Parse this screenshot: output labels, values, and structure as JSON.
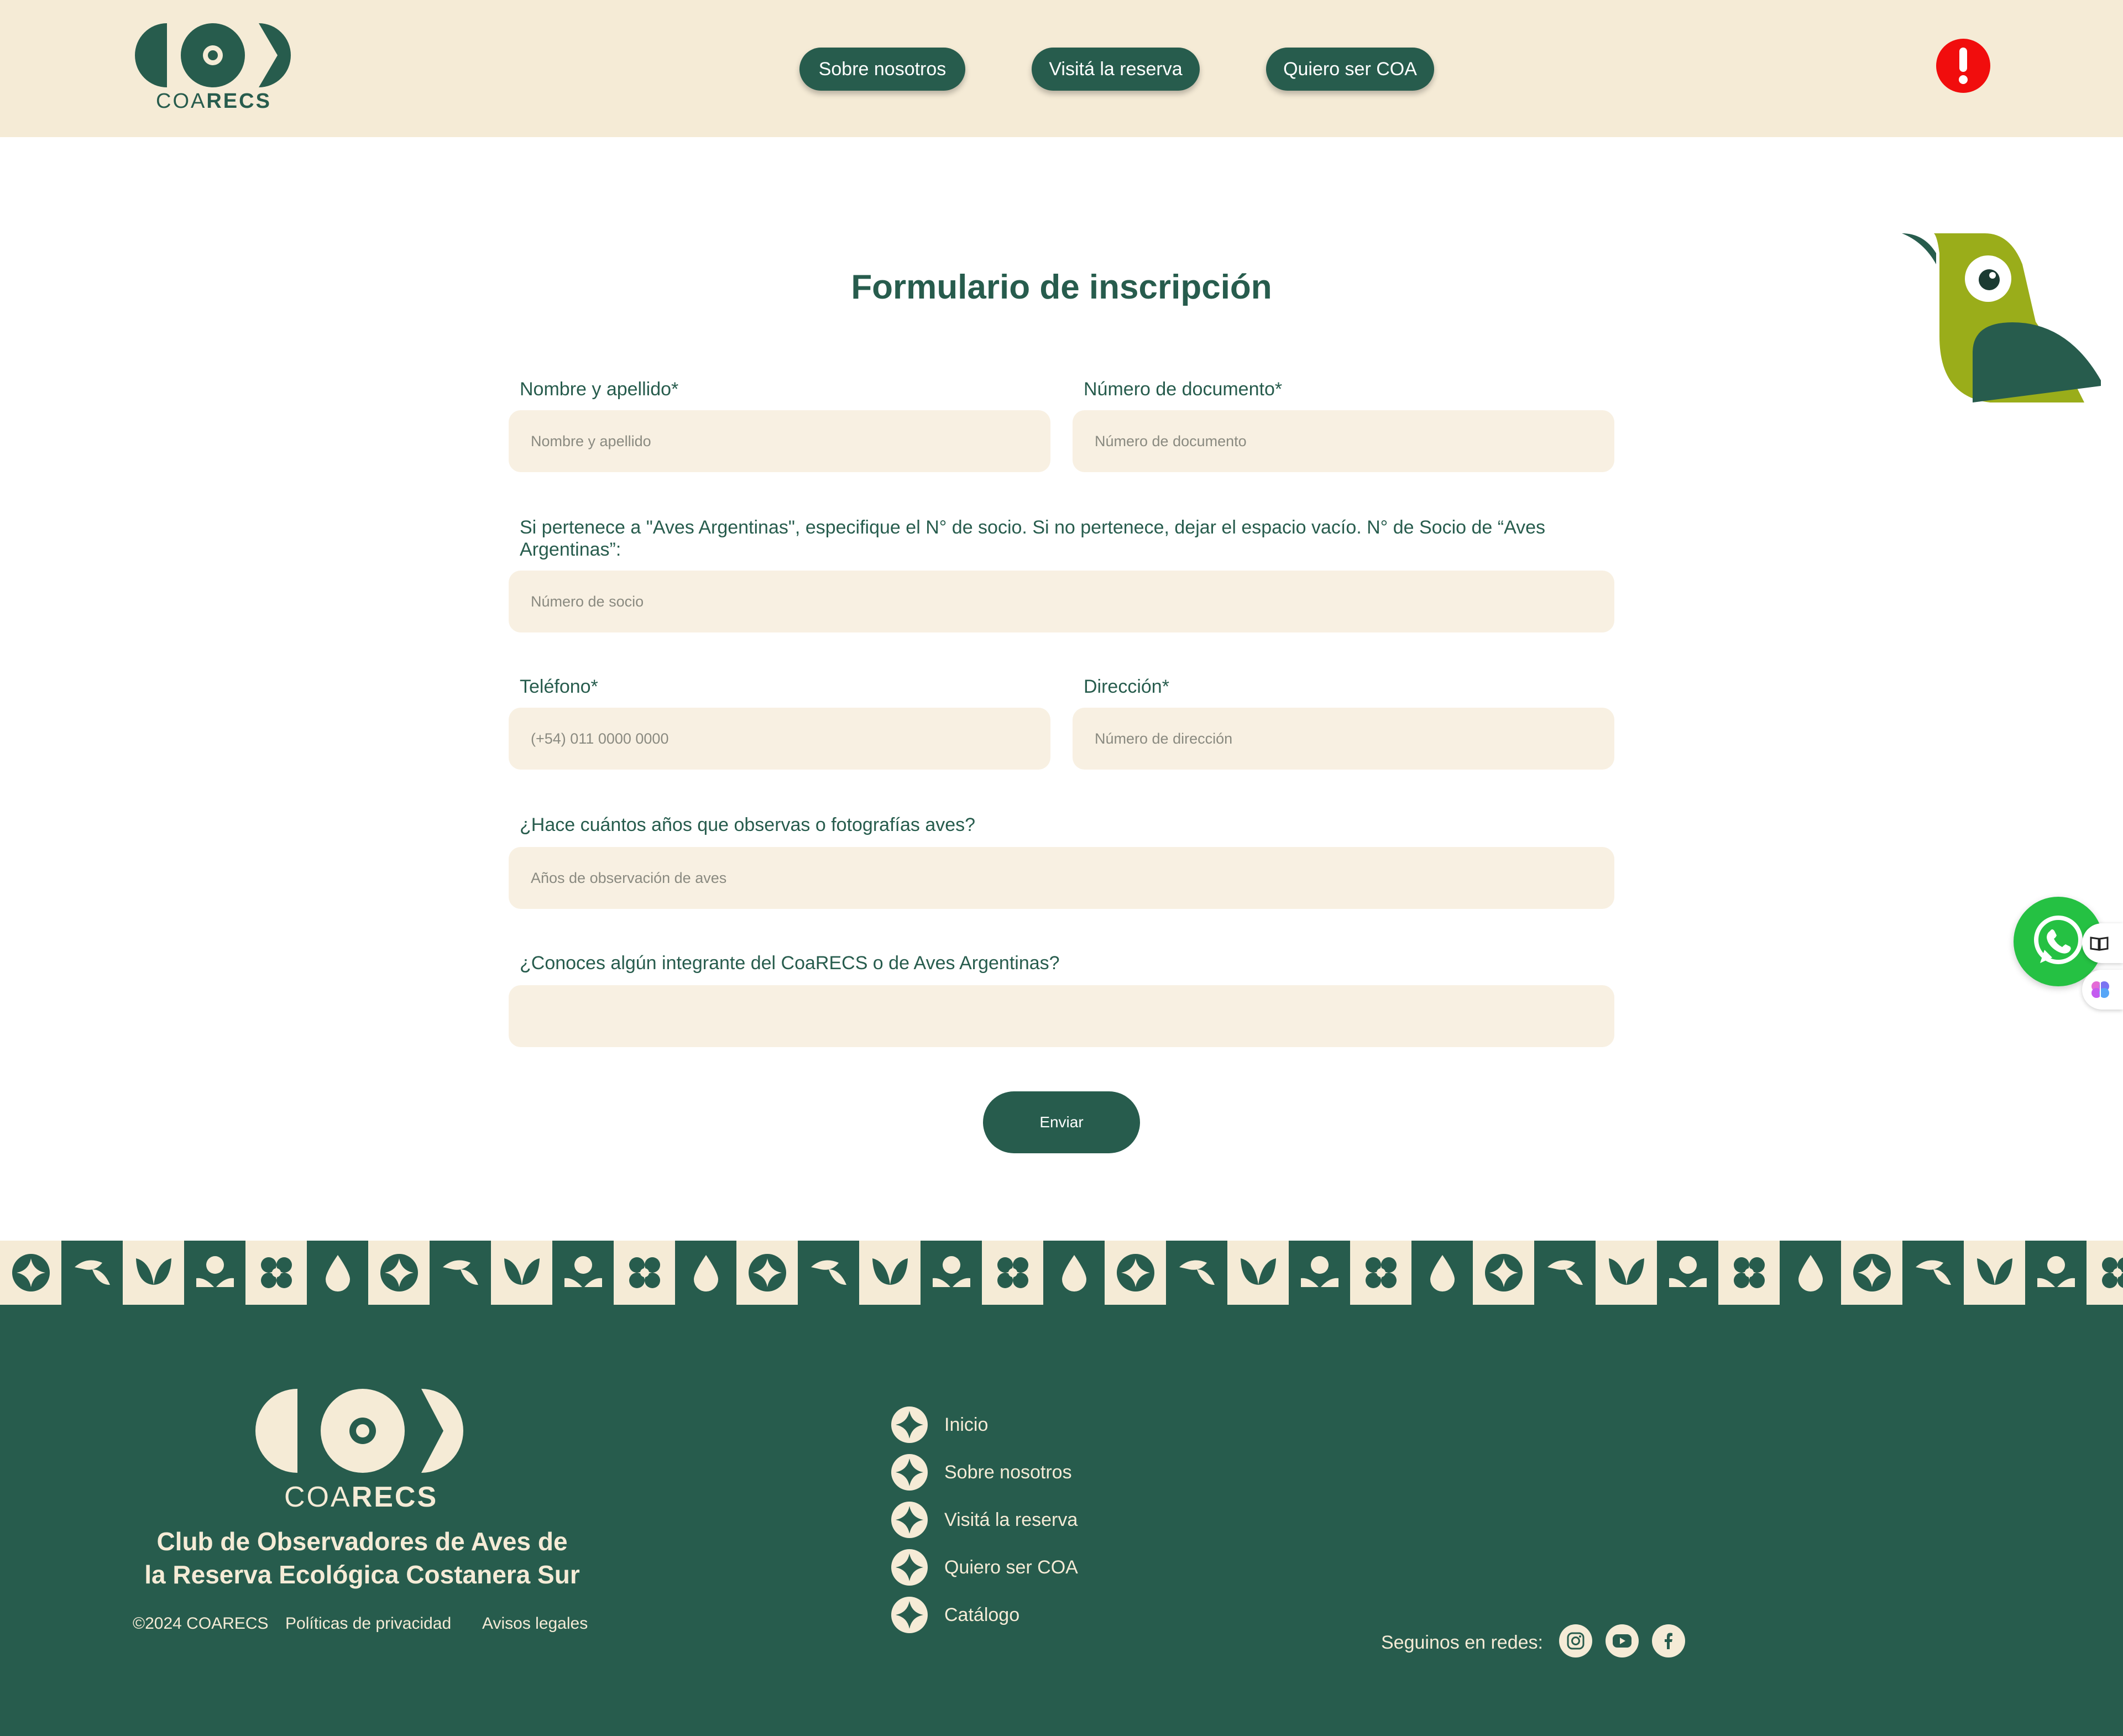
{
  "header": {
    "logo_text_light": "COA",
    "logo_text_bold": "RECS",
    "nav": [
      {
        "label": "Sobre nosotros"
      },
      {
        "label": "Visitá la reserva"
      },
      {
        "label": "Quiero ser COA"
      }
    ],
    "alert_symbol": "!"
  },
  "form": {
    "title": "Formulario de inscripción",
    "fields": {
      "name": {
        "label": "Nombre y apellido*",
        "placeholder": "Nombre y apellido"
      },
      "document": {
        "label": "Número de documento*",
        "placeholder": "Número de documento"
      },
      "member": {
        "label": "Si pertenece a \"Aves Argentinas\", especifique el N° de socio. Si no pertenece, dejar el espacio vacío. N° de Socio de “Aves Argentinas”:",
        "placeholder": "Número de socio"
      },
      "phone": {
        "label": "Teléfono*",
        "placeholder": "(+54) 011 0000 0000"
      },
      "address": {
        "label": "Dirección*",
        "placeholder": "Número de dirección"
      },
      "years": {
        "label": "¿Hace cuántos años que observas o fotografías aves?",
        "placeholder": "Años de observación de aves"
      },
      "known": {
        "label": "¿Conoces algún integrante del CoaRECS o de Aves Argentinas?",
        "placeholder": ""
      }
    },
    "submit_label": "Enviar"
  },
  "pattern_icons": [
    "star-icon",
    "leaf-icon",
    "tulip-icon",
    "sprout-icon",
    "flower-icon",
    "drop-icon"
  ],
  "footer": {
    "logo_text_light": "COA",
    "logo_text_bold": "RECS",
    "tagline_line1": "Club de Observadores de Aves de",
    "tagline_line2": "la Reserva Ecológica Costanera Sur",
    "copyright": "©2024 COARECS",
    "privacy": "Políticas de privacidad",
    "legal": "Avisos legales",
    "nav": [
      {
        "label": "Inicio"
      },
      {
        "label": "Sobre nosotros"
      },
      {
        "label": "Visitá la reserva"
      },
      {
        "label": "Quiero ser COA"
      },
      {
        "label": "Catálogo"
      }
    ],
    "social_label": "Seguinos en redes:",
    "social": [
      "instagram-icon",
      "youtube-icon",
      "facebook-icon"
    ]
  },
  "colors": {
    "primary_green": "#275c4d",
    "cream": "#f5ebd6",
    "field_bg": "#f8f0e2",
    "bird_lime": "#9aad1a",
    "alert_red": "#f10d0d",
    "whatsapp_green": "#25c143"
  }
}
